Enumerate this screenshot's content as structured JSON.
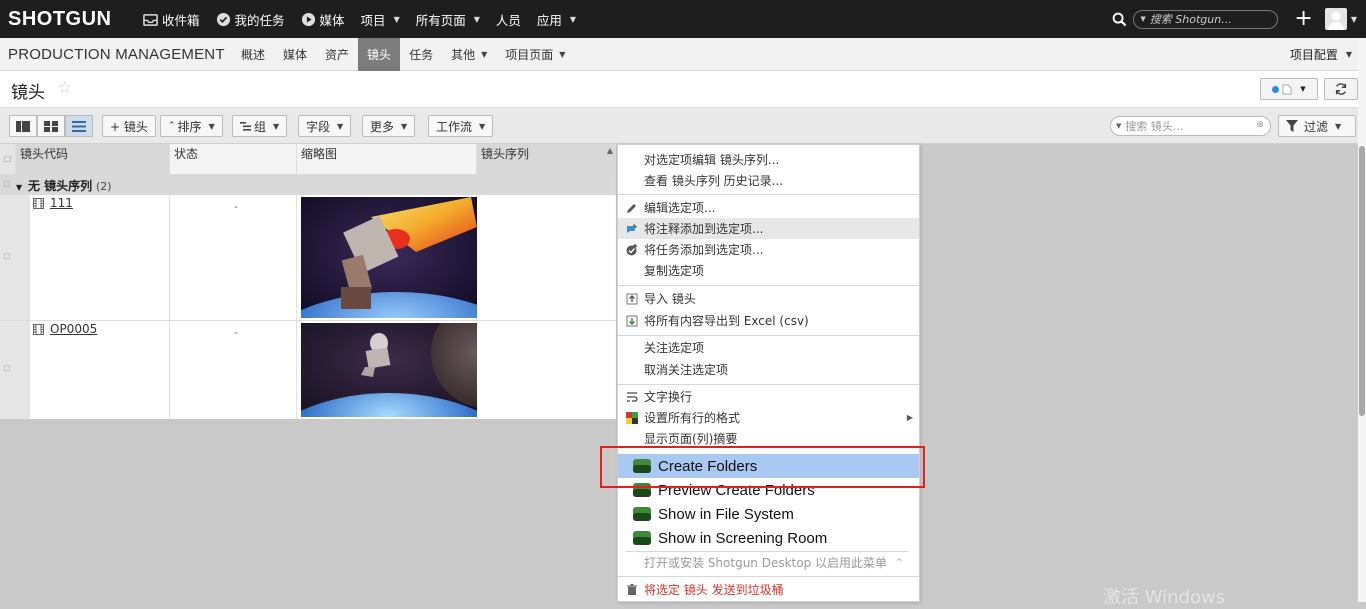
{
  "topbar": {
    "logo": "SHOTGUN",
    "items": [
      {
        "label": "收件箱"
      },
      {
        "label": "我的任务"
      },
      {
        "label": "媒体"
      },
      {
        "label": "项目"
      },
      {
        "label": "所有页面"
      },
      {
        "label": "人员"
      },
      {
        "label": "应用"
      }
    ],
    "search_placeholder": "搜索 Shotgun..."
  },
  "secondary_nav": {
    "project_name": "PRODUCTION MANAGEMENT",
    "tabs": [
      {
        "label": "概述"
      },
      {
        "label": "媒体"
      },
      {
        "label": "资产"
      },
      {
        "label": "镜头",
        "active": true
      },
      {
        "label": "任务"
      },
      {
        "label": "其他"
      },
      {
        "label": "项目页面"
      }
    ],
    "project_config": "项目配置"
  },
  "page": {
    "title": "镜头"
  },
  "toolbar": {
    "add_shot": "+ 镜头",
    "sort": "排序",
    "group": "组",
    "fields": "字段",
    "more": "更多",
    "workflow": "工作流",
    "search_placeholder": "搜索 镜头...",
    "filter": "过滤"
  },
  "grid": {
    "columns": [
      "镜头代码",
      "状态",
      "缩略图",
      "镜头序列"
    ],
    "group_label": "无 镜头序列",
    "group_count": "(2)",
    "rows": [
      {
        "code": "111",
        "status": "-"
      },
      {
        "code": "OP0005",
        "status": "-"
      }
    ]
  },
  "context_menu": {
    "items": [
      {
        "label": "对选定项编辑 镜头序列..."
      },
      {
        "label": "查看 镜头序列 历史记录..."
      },
      {
        "label": "编辑选定项..."
      },
      {
        "label": "将注释添加到选定项..."
      },
      {
        "label": "将任务添加到选定项..."
      },
      {
        "label": "复制选定项"
      },
      {
        "label": "导入 镜头"
      },
      {
        "label": "将所有内容导出到 Excel (csv)"
      },
      {
        "label": "关注选定项"
      },
      {
        "label": "取消关注选定项"
      },
      {
        "label": "文字换行"
      },
      {
        "label": "设置所有行的格式"
      },
      {
        "label": "显示页面(列)摘要"
      }
    ],
    "toolkit_items": [
      {
        "label": "Create Folders"
      },
      {
        "label": "Preview Create Folders"
      },
      {
        "label": "Show in File System"
      },
      {
        "label": "Show in Screening Room"
      }
    ],
    "desktop_hint": "打开或安装 Shotgun Desktop 以启用此菜单",
    "trash": "将选定 镜头 发送到垃圾桶"
  },
  "watermark": "激活 Windows",
  "colors": {
    "topbar_bg": "#1e1e1e",
    "active_tab": "#7c7c7c",
    "menu_highlight": "#a9c8f2",
    "trash_text": "#d9342b",
    "annotation_red": "#e02020"
  }
}
